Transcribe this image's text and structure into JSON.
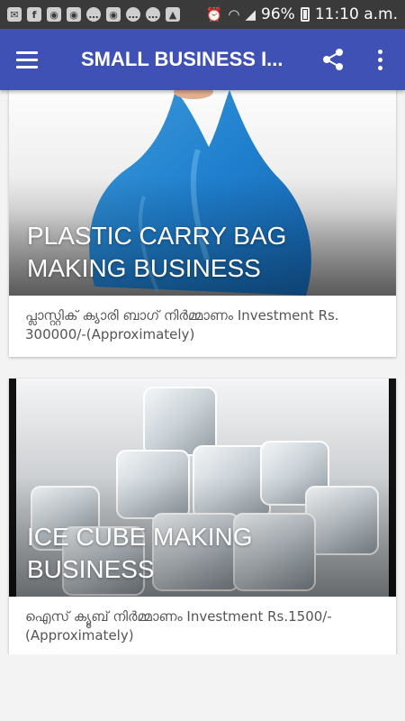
{
  "status_bar": {
    "battery": "96%",
    "time": "11:10 a.m."
  },
  "app_bar": {
    "title": "SMALL BUSINESS I..."
  },
  "cards": [
    {
      "title_line1": "PLASTIC CARRY BAG",
      "title_line2": "MAKING BUSINESS",
      "description": "പ്ലാസ്റ്റിക് ക്യാരി ബാഗ് നിർമ്മാണം Investment Rs. 300000/-(Approximately)"
    },
    {
      "title_line1": "ICE CUBE MAKING",
      "title_line2": "BUSINESS",
      "description": "ഐസ് ക്യൂബ് നിർമ്മാണം Investment Rs.1500/-(Approximately)"
    }
  ]
}
